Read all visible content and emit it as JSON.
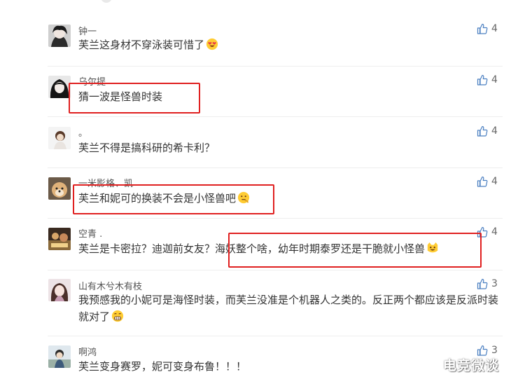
{
  "comments": [
    {
      "username": "钟一",
      "text": "芙兰这身材不穿泳装可惜了",
      "likes": "4",
      "emoji": "heart-eyes-emoji"
    },
    {
      "username": "乌尔提",
      "text": "猜一波是怪兽时装",
      "likes": "4"
    },
    {
      "username": "。",
      "text": "芙兰不得是搞科研的希卡利？",
      "likes": "4"
    },
    {
      "username": "一米影格、凯",
      "text": "芙兰和妮可的换装不会是小怪兽吧",
      "likes": "4",
      "emoji": "thinking-emoji"
    },
    {
      "username": "空青 .",
      "text": "芙兰是卡密拉？迪迦前女友？海妖整个啥，幼年时期泰罗还是干脆就小怪兽",
      "likes": "4",
      "emoji": "cat-emoji"
    },
    {
      "username": "山有木兮木有枝",
      "text": "我预感我的小妮可是海怪时装，而芙兰没准是个机器人之类的。反正两个都应该是反派时装就对了",
      "likes": "3",
      "emoji": "grin-emoji"
    },
    {
      "username": "啊鸿",
      "text": "芙兰变身赛罗，妮可变身布鲁！！！",
      "likes": "3"
    }
  ],
  "watermark": "电竞微谈",
  "colors": {
    "highlight": "#e02020",
    "like_icon": "#4a7fc1"
  }
}
